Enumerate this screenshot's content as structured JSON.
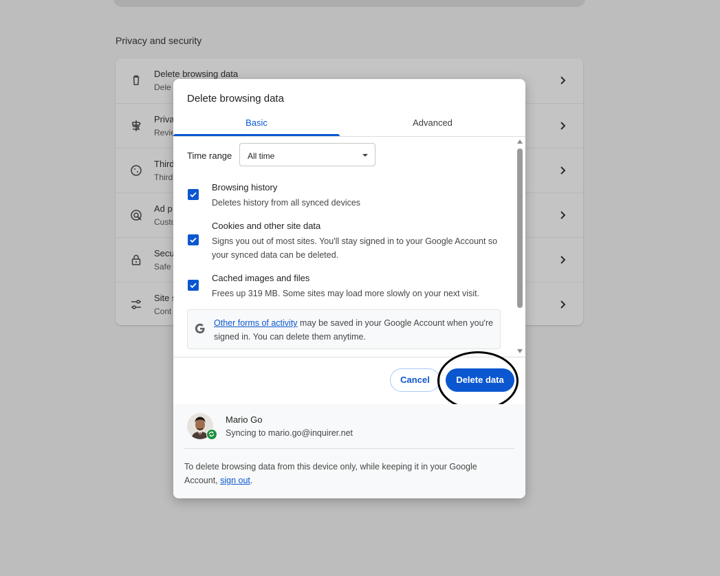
{
  "background": {
    "section_title": "Privacy and security",
    "rows": [
      {
        "title": "Delete browsing data",
        "sub": "Dele",
        "icon": "trash-icon"
      },
      {
        "title": "Priva",
        "sub": "Revie",
        "icon": "privacy-guide-icon"
      },
      {
        "title": "Third",
        "sub": "Third",
        "icon": "cookie-icon"
      },
      {
        "title": "Ad p",
        "sub": "Custo",
        "icon": "ad-privacy-icon"
      },
      {
        "title": "Secu",
        "sub": "Safe",
        "icon": "lock-icon"
      },
      {
        "title": "Site s",
        "sub": "Cont",
        "icon": "site-settings-icon"
      }
    ]
  },
  "dialog": {
    "title": "Delete browsing data",
    "tabs": {
      "basic": "Basic",
      "advanced": "Advanced"
    },
    "time_range": {
      "label": "Time range",
      "value": "All time"
    },
    "options": [
      {
        "title": "Browsing history",
        "desc": "Deletes history from all synced devices",
        "checked": true
      },
      {
        "title": "Cookies and other site data",
        "desc": "Signs you out of most sites. You'll stay signed in to your Google Account so your synced data can be deleted.",
        "checked": true
      },
      {
        "title": "Cached images and files",
        "desc": "Frees up 319 MB. Some sites may load more slowly on your next visit.",
        "checked": true
      }
    ],
    "google_note": {
      "link": "Other forms of activity",
      "text": " may be saved in your Google Account when you're signed in. You can delete them anytime."
    },
    "buttons": {
      "cancel": "Cancel",
      "delete": "Delete data"
    },
    "account": {
      "name": "Mario Go",
      "sync": "Syncing to mario.go@inquirer.net"
    },
    "signout_note": {
      "text": "To delete browsing data from this device only, while keeping it in your Google Account, ",
      "link": "sign out",
      "end": "."
    }
  },
  "colors": {
    "accent": "#0b57d0",
    "sync_green": "#1e8e3e",
    "overlay": "#bdbdbd"
  }
}
